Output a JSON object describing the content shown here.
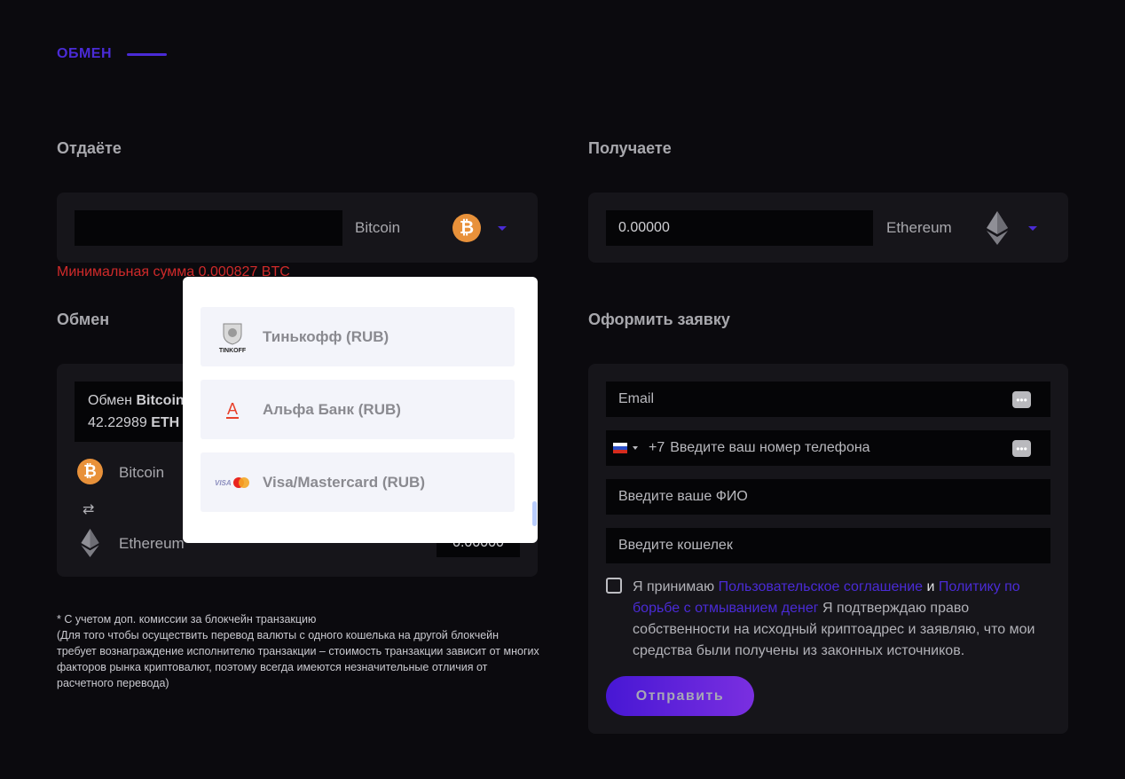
{
  "section": {
    "title": "ОБМЕН"
  },
  "give": {
    "heading": "Отдаёте",
    "amount_value": "",
    "currency": "Bitcoin",
    "currency_icon": "bitcoin-icon",
    "error": "Минимальная сумма 0.000827 BTC"
  },
  "receive": {
    "heading": "Получаете",
    "amount_value": "0.00000",
    "currency": "Ethereum",
    "currency_icon": "ethereum-icon"
  },
  "exchange": {
    "heading": "Обмен",
    "summary_prefix": "Обмен",
    "summary_from": "Bitcoin",
    "summary_amount": "42.22989",
    "summary_to": "ETH",
    "from_coin": "Bitcoin",
    "to_coin": "Ethereum",
    "to_value": "0.00000"
  },
  "dropdown": {
    "options": [
      {
        "label": "Тинькофф (RUB)",
        "icon": "tinkoff-logo-icon",
        "logo_text": "TINKOFF"
      },
      {
        "label": "Альфа Банк (RUB)",
        "icon": "alfa-bank-logo-icon",
        "logo_text": "А"
      },
      {
        "label": "Visa/Mastercard (RUB)",
        "icon": "visa-mastercard-logo-icon",
        "logo_text": "VISA"
      }
    ]
  },
  "footnote": {
    "line1": "* С учетом доп. комиссии за блокчейн транзакцию",
    "line2": "(Для того чтобы осуществить перевод валюты с одного кошелька на другой блокчейн требует вознаграждение исполнителю транзакции – стоимость транзакции зависит от многих факторов рынка криптовалют, поэтому всегда имеются незначительные отличия от расчетного перевода)"
  },
  "order": {
    "heading": "Оформить заявку",
    "email_placeholder": "Email",
    "phone_code": "+7",
    "phone_placeholder": "Введите ваш номер телефона",
    "name_placeholder": "Введите ваше ФИО",
    "wallet_placeholder": "Введите кошелек",
    "dots": "•••",
    "consent_prefix": "Я принимаю",
    "agreement_link": "Пользовательское соглашение",
    "and": "и",
    "aml_link": "Политику по борьбе с отмыванием денег",
    "consent_suffix": "Я подтверждаю право собственности на исходный криптоадрес и заявляю, что мои средства были получены из законных источников.",
    "submit": "Отправить"
  },
  "colors": {
    "accent": "#4a2bd6",
    "error": "#d02a2a",
    "bitcoin": "#e8913a",
    "background": "#0b0a0e",
    "panel": "#16151a"
  }
}
